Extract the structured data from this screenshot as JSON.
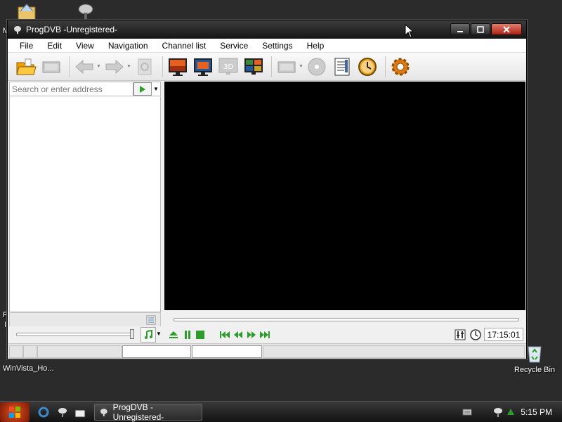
{
  "desktop": {
    "icons": [
      {
        "label": "WinVista_Ho...",
        "icon": "winvista-icon"
      },
      {
        "label": "Recycle Bin",
        "icon": "recycle-bin-icon"
      }
    ],
    "edge_text": {
      "top_left": "M",
      "mid_left_1": "R",
      "mid_left_2": "I"
    }
  },
  "window": {
    "title": "ProgDVB -Unregistered-",
    "controls": [
      "minimize",
      "maximize",
      "close"
    ]
  },
  "menu": {
    "items": [
      "File",
      "Edit",
      "View",
      "Navigation",
      "Channel list",
      "Service",
      "Settings",
      "Help"
    ]
  },
  "toolbar": {
    "buttons": [
      "open-folder-icon",
      "recordings-icon",
      "back-arrow-icon",
      "forward-arrow-icon",
      "scan-icon",
      "tv-mode-1-icon",
      "tv-mode-2-icon",
      "3d-mode-icon",
      "mosaic-icon",
      "film-icon",
      "disc-icon",
      "epg-icon",
      "scheduler-clock-icon",
      "settings-gear-icon"
    ]
  },
  "search": {
    "placeholder": "Search or enter address"
  },
  "player": {
    "time": "17:15:01"
  },
  "taskbar": {
    "task_label": "ProgDVB -Unregistered-",
    "clock": "5:15 PM"
  },
  "colors": {
    "accent_green": "#2a9d2a",
    "titlebar": "#1e1e1e",
    "video_bg": "#000000"
  }
}
